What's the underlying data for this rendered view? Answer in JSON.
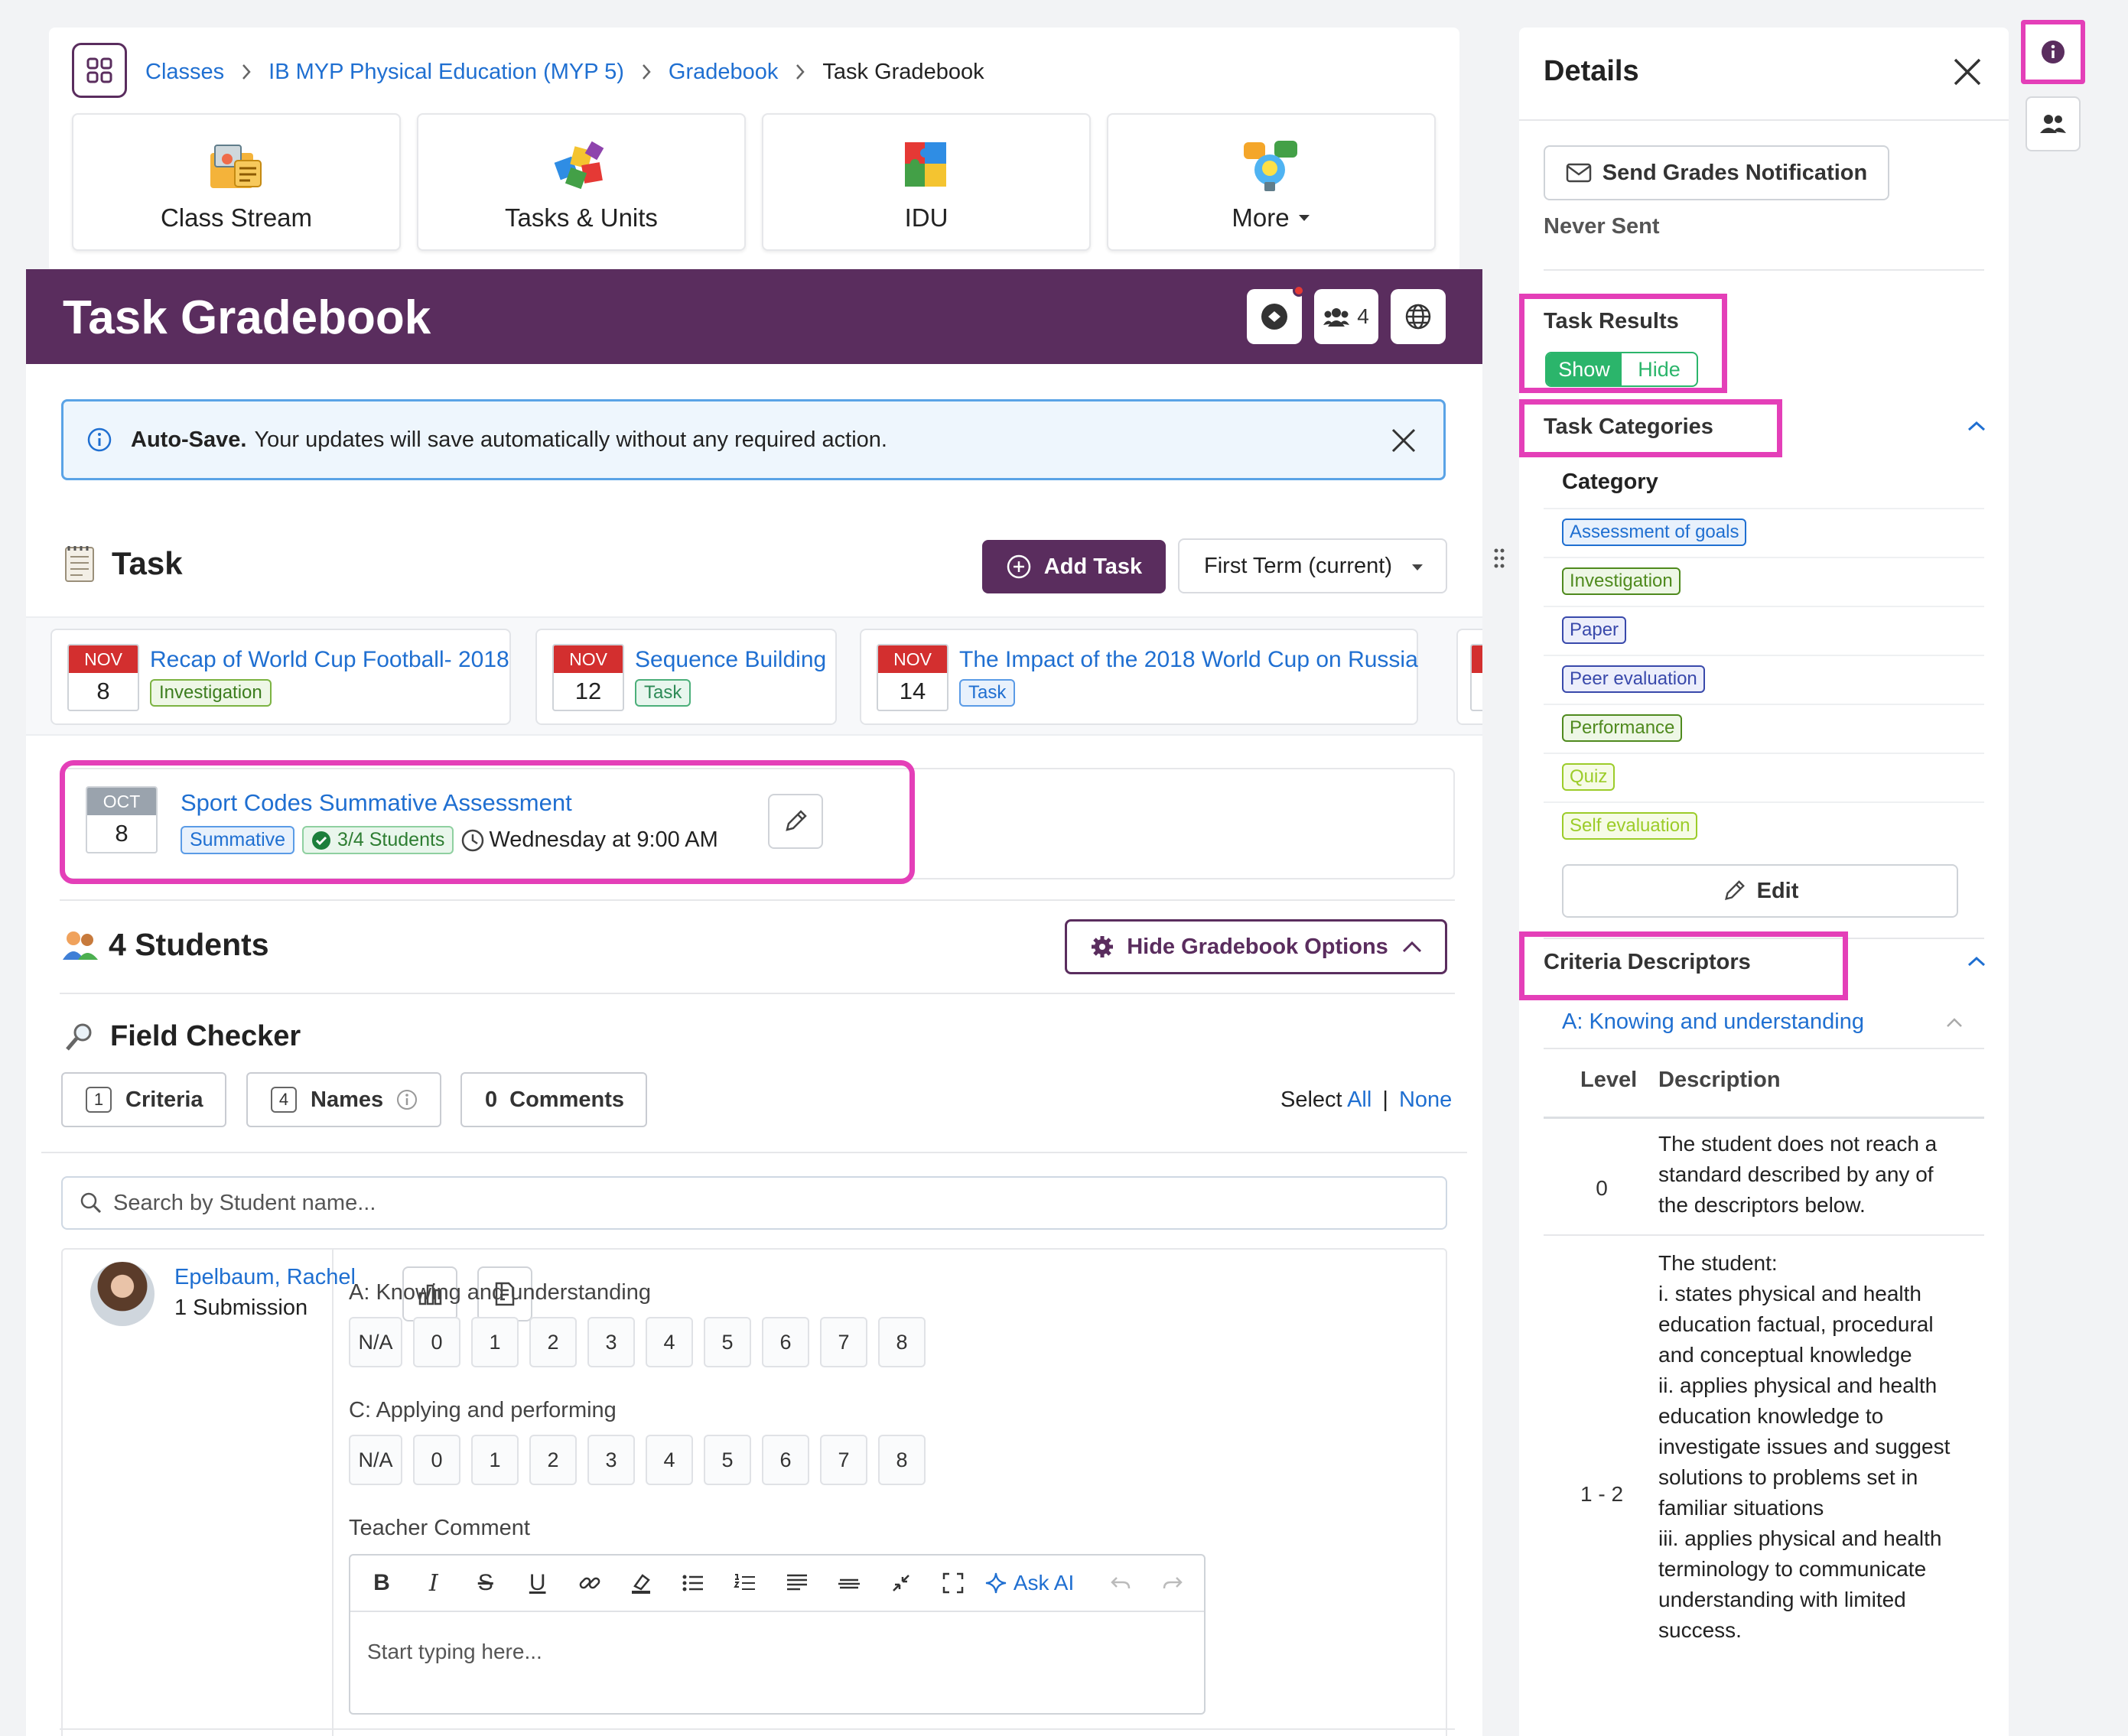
{
  "breadcrumb": {
    "items": [
      "Classes",
      "IB MYP Physical Education (MYP 5)",
      "Gradebook"
    ],
    "current": "Task Gradebook"
  },
  "quick_links": [
    {
      "label": "Class Stream",
      "icon": "class-stream-icon"
    },
    {
      "label": "Tasks & Units",
      "icon": "puzzle-icon"
    },
    {
      "label": "IDU",
      "icon": "idu-puzzle-icon"
    },
    {
      "label": "More",
      "icon": "lightbulb-chat-icon"
    }
  ],
  "header": {
    "title": "Task Gradebook",
    "group_count": "4"
  },
  "autosave": {
    "bold": "Auto-Save.",
    "text": "Your updates will save automatically without any required action."
  },
  "task_section": {
    "title": "Task",
    "add_task_label": "Add Task",
    "term": "First Term (current)"
  },
  "tasks": [
    {
      "month": "NOV",
      "day": "8",
      "name": "Recap of World Cup Football- 2018",
      "badge": "Investigation"
    },
    {
      "month": "NOV",
      "day": "12",
      "name": "Sequence Building",
      "badge": "Task"
    },
    {
      "month": "NOV",
      "day": "14",
      "name": "The Impact of the 2018 World Cup on Russia",
      "badge": "Task"
    }
  ],
  "selected_task": {
    "month": "OCT",
    "day": "8",
    "name": "Sport Codes Summative Assessment",
    "category": "Summative",
    "students": "3/4 Students",
    "due": "Wednesday at 9:00 AM"
  },
  "students_section": {
    "title": "4 Students",
    "options_label": "Hide Gradebook Options"
  },
  "field_checker": {
    "title": "Field Checker",
    "chips": [
      {
        "count": "1",
        "label": "Criteria"
      },
      {
        "count": "4",
        "label": "Names"
      },
      {
        "count": "0",
        "label": "Comments"
      }
    ],
    "select_label": "Select",
    "select_all": "All",
    "select_sep": "|",
    "select_none": "None"
  },
  "search": {
    "placeholder": "Search by Student name..."
  },
  "student": {
    "name": "Epelbaum, Rachel",
    "submissions": "1 Submission",
    "criteria": [
      {
        "label": "A: Knowing and understanding",
        "levels": [
          "N/A",
          "0",
          "1",
          "2",
          "3",
          "4",
          "5",
          "6",
          "7",
          "8"
        ]
      },
      {
        "label": "C: Applying and performing",
        "levels": [
          "N/A",
          "0",
          "1",
          "2",
          "3",
          "4",
          "5",
          "6",
          "7",
          "8"
        ]
      }
    ],
    "comment_label": "Teacher Comment",
    "ask_ai": "Ask AI",
    "comment_placeholder": "Start typing here..."
  },
  "details": {
    "title": "Details",
    "send_label": "Send Grades Notification",
    "sent_status": "Never Sent",
    "task_results": {
      "title": "Task Results",
      "show": "Show",
      "hide": "Hide"
    },
    "task_categories": {
      "title": "Task Categories",
      "column": "Category",
      "items": [
        {
          "label": "Assessment of goals",
          "color": "#1f6fd1"
        },
        {
          "label": "Investigation",
          "color": "#4f8a1e"
        },
        {
          "label": "Paper",
          "color": "#3949ab"
        },
        {
          "label": "Peer evaluation",
          "color": "#3949ab"
        },
        {
          "label": "Performance",
          "color": "#4f8a1e"
        },
        {
          "label": "Quiz",
          "color": "#9ccc29"
        },
        {
          "label": "Self evaluation",
          "color": "#9ccc29"
        }
      ],
      "edit_label": "Edit"
    },
    "criteria_descriptors": {
      "title": "Criteria Descriptors",
      "criterion": "A: Knowing and understanding",
      "col_level": "Level",
      "col_desc": "Description",
      "rows": [
        {
          "level": "0",
          "text": "The student does not reach a standard described by any of the descriptors below."
        },
        {
          "level": "1 - 2",
          "text": "The student:\ni. states physical and health education factual, procedural and conceptual knowledge\nii. applies physical and health education knowledge to investigate issues and suggest solutions to problems set in familiar situations\niii. applies physical and health terminology to communicate understanding with limited success."
        }
      ]
    }
  }
}
